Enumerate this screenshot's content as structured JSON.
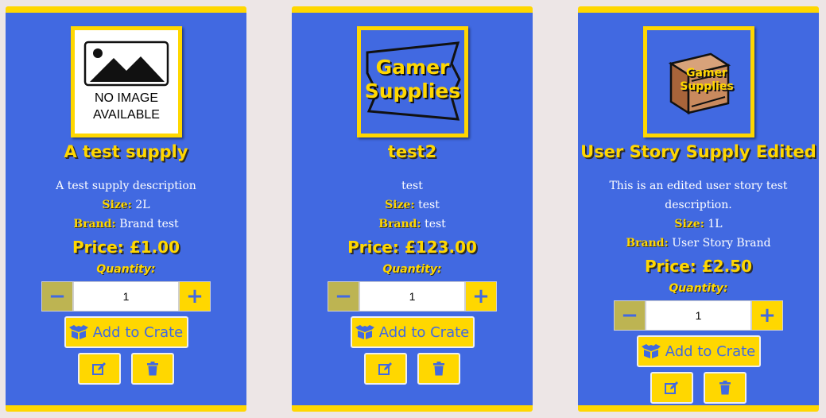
{
  "labels": {
    "size": "Size:",
    "brand": "Brand:",
    "quantity": "Quantity:",
    "add_to_crate": "Add to Crate",
    "minus": "−",
    "plus": "+"
  },
  "products": [
    {
      "image_text_line1": "NO IMAGE",
      "image_text_line2": "AVAILABLE",
      "name": "A test supply",
      "description": "A test supply description",
      "size": "2L",
      "brand": "Brand test",
      "price": "Price: £1.00",
      "quantity": "1"
    },
    {
      "image_text_line1": "Gamer",
      "image_text_line2": "Supplies",
      "name": "test2",
      "description": "test",
      "size": "test",
      "brand": "test",
      "price": "Price: £123.00",
      "quantity": "1"
    },
    {
      "image_text_line1": "Gamer",
      "image_text_line2": "Supplies",
      "name": "User Story Supply Edited",
      "description": "This is an edited user story test description.",
      "size": "1L",
      "brand": "User Story Brand",
      "price": "Price: £2.50",
      "quantity": "1"
    }
  ],
  "icons": {
    "crate": "box-open-icon",
    "edit": "edit-icon",
    "delete": "trash-icon",
    "no_image": "no-image-icon"
  },
  "colors": {
    "card_bg": "#4169e1",
    "accent": "#ffd700",
    "page_bg": "#ede6e6",
    "minus_bg": "#bdb452"
  }
}
